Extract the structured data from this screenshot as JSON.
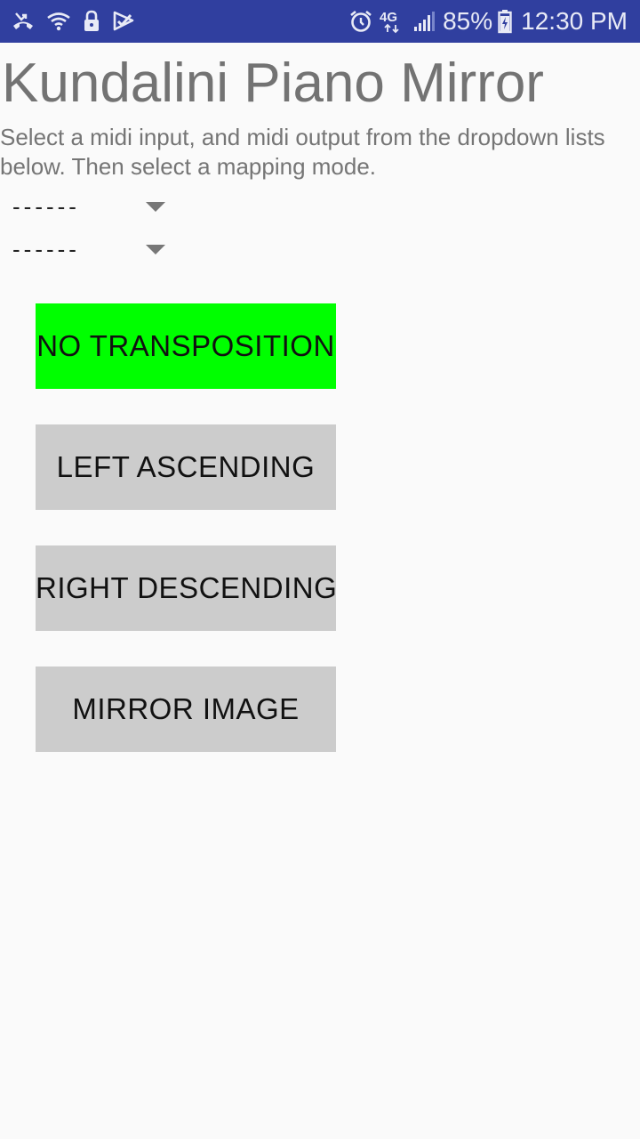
{
  "status_bar": {
    "battery_percent": "85%",
    "time": "12:30 PM",
    "network_label": "4G",
    "background_color": "#303f9f",
    "icons": [
      "missed-call-icon",
      "wifi-icon",
      "lock-icon",
      "checkmark-flag-icon",
      "alarm-icon",
      "network-4g-icon",
      "signal-icon",
      "battery-icon"
    ]
  },
  "app": {
    "title": "Kundalini Piano Mirror",
    "instructions": "Select a midi input, and midi output from the dropdown lists below. Then select a mapping mode."
  },
  "spinners": {
    "midi_input": {
      "selected": "------"
    },
    "midi_output": {
      "selected": "------"
    }
  },
  "mapping_modes": {
    "active_color": "#00ff00",
    "inactive_color": "#cccccc",
    "selected": "no_transposition",
    "no_transposition": "NO TRANSPOSITION",
    "left_ascending": "LEFT ASCENDING",
    "right_descending": "RIGHT DESCENDING",
    "mirror_image": "MIRROR IMAGE"
  }
}
